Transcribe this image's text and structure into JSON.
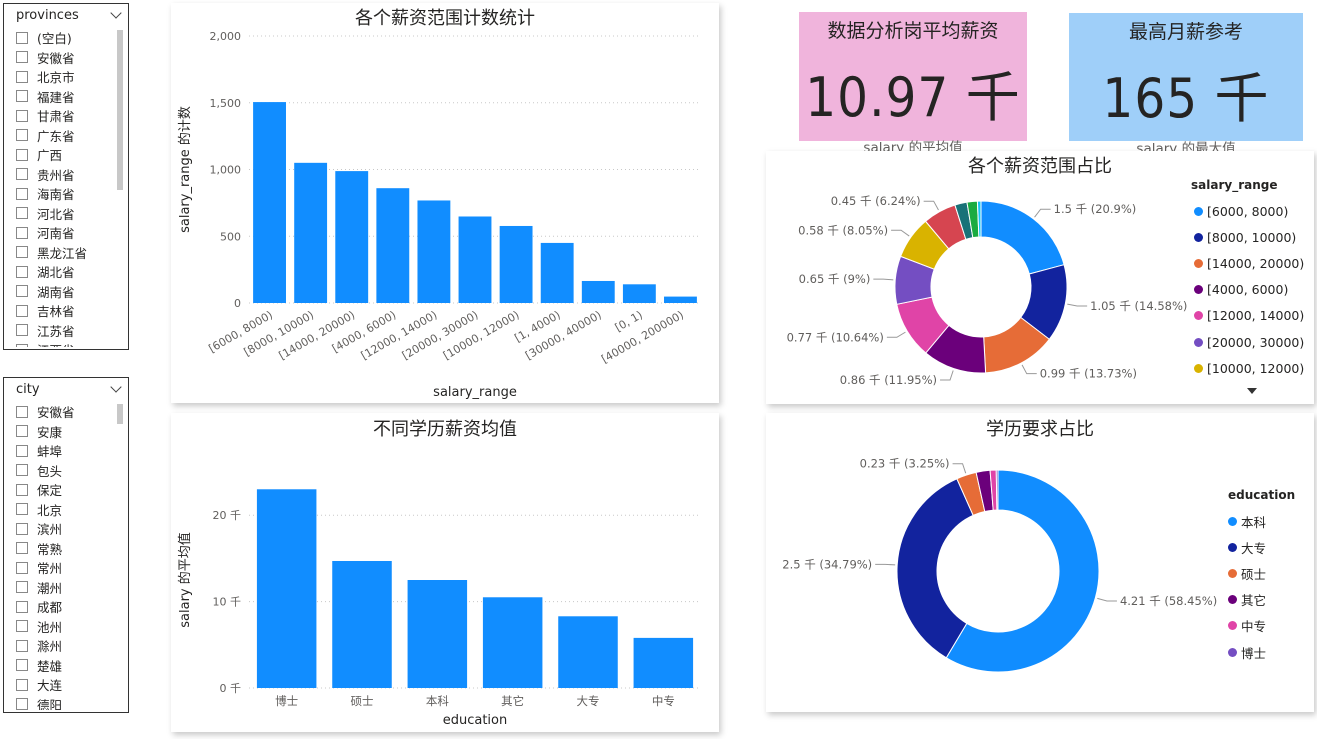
{
  "slicers": {
    "provinces": {
      "title": "provinces",
      "items": [
        "(空白)",
        "安徽省",
        "北京市",
        "福建省",
        "甘肃省",
        "广东省",
        "广西",
        "贵州省",
        "海南省",
        "河北省",
        "河南省",
        "黑龙江省",
        "湖北省",
        "湖南省",
        "吉林省",
        "江苏省",
        "江西省"
      ]
    },
    "city": {
      "title": "city",
      "items": [
        "安徽省",
        "安康",
        "蚌埠",
        "包头",
        "保定",
        "北京",
        "滨州",
        "常熟",
        "常州",
        "潮州",
        "成都",
        "池州",
        "滁州",
        "楚雄",
        "大连",
        "德阳"
      ]
    }
  },
  "kpis": {
    "avg_salary": {
      "title": "数据分析岗平均薪资",
      "value": "10.97 千",
      "subtitle": "salary 的平均值",
      "bg": "#f0b4dc"
    },
    "max_salary": {
      "title": "最高月薪参考",
      "value": "165 千",
      "subtitle": "salary 的最大值",
      "bg": "#9fcff9"
    }
  },
  "chart_data": [
    {
      "id": "salary_range_count",
      "type": "bar",
      "title": "各个薪资范围计数统计",
      "xlabel": "salary_range",
      "ylabel": "salary_range 的计数",
      "categories": [
        "[6000, 8000)",
        "[8000, 10000)",
        "[14000, 20000)",
        "[4000, 6000)",
        "[12000, 14000)",
        "[20000, 30000)",
        "[10000, 12000)",
        "[1, 4000)",
        "[30000, 40000)",
        "[0, 1)",
        "[40000, 200000)"
      ],
      "values": [
        1505,
        1050,
        988,
        860,
        768,
        648,
        577,
        450,
        165,
        140,
        48
      ],
      "ylim": [
        0,
        2000
      ],
      "yticks": [
        0,
        500,
        1000,
        1500,
        2000
      ],
      "ytick_labels": [
        "0",
        "500",
        "1,000",
        "1,500",
        "2,000"
      ],
      "color": "#118dff",
      "grid": true
    },
    {
      "id": "salary_range_share",
      "type": "pie",
      "donut": true,
      "title": "各个薪资范围占比",
      "legend_title": "salary_range",
      "legend_position": "right",
      "slices": [
        {
          "name": "[6000, 8000)",
          "value": 1.5,
          "label": "1.5 千 (20.9%)",
          "color": "#118dff",
          "show_label": true,
          "show_legend": true
        },
        {
          "name": "[8000, 10000)",
          "value": 1.05,
          "label": "1.05 千 (14.58%)",
          "color": "#12239e",
          "show_label": true,
          "show_legend": true
        },
        {
          "name": "[14000, 20000)",
          "value": 0.99,
          "label": "0.99 千 (13.73%)",
          "color": "#e66c37",
          "show_label": true,
          "show_legend": true
        },
        {
          "name": "[4000, 6000)",
          "value": 0.86,
          "label": "0.86 千 (11.95%)",
          "color": "#6b007b",
          "show_label": true,
          "show_legend": true
        },
        {
          "name": "[12000, 14000)",
          "value": 0.77,
          "label": "0.77 千 (10.64%)",
          "color": "#e044a7",
          "show_label": true,
          "show_legend": true
        },
        {
          "name": "[20000, 30000)",
          "value": 0.65,
          "label": "0.65 千 (9%)",
          "color": "#744ec2",
          "show_label": true,
          "show_legend": true
        },
        {
          "name": "[10000, 12000)",
          "value": 0.58,
          "label": "0.58 千 (8.05%)",
          "color": "#d9b300",
          "show_label": true,
          "show_legend": true
        },
        {
          "name": "[1, 4000)",
          "value": 0.45,
          "label": "0.45 千 (6.24%)",
          "color": "#d64550",
          "show_label": true,
          "show_legend": false
        },
        {
          "name": "[30000, 40000)",
          "value": 0.165,
          "label": "",
          "color": "#197278",
          "show_label": false,
          "show_legend": false
        },
        {
          "name": "[0, 1)",
          "value": 0.14,
          "label": "",
          "color": "#1aab40",
          "show_label": false,
          "show_legend": false
        },
        {
          "name": "[40000, 200000)",
          "value": 0.048,
          "label": "",
          "color": "#15c6f4",
          "show_label": false,
          "show_legend": false
        }
      ]
    },
    {
      "id": "education_avg_salary",
      "type": "bar",
      "title": "不同学历薪资均值",
      "xlabel": "education",
      "ylabel": "salary 的平均值",
      "categories": [
        "博士",
        "硕士",
        "本科",
        "其它",
        "大专",
        "中专"
      ],
      "values": [
        23,
        14.7,
        12.5,
        10.5,
        8.3,
        5.8
      ],
      "ylim": [
        0,
        25
      ],
      "yticks": [
        0,
        10,
        20
      ],
      "ytick_labels": [
        "0 千",
        "10 千",
        "20 千"
      ],
      "color": "#118dff",
      "grid": true
    },
    {
      "id": "education_share",
      "type": "pie",
      "donut": true,
      "title": "学历要求占比",
      "legend_title": "education",
      "legend_position": "right",
      "slices": [
        {
          "name": "本科",
          "value": 4.21,
          "label": "4.21 千 (58.45%)",
          "color": "#118dff",
          "show_label": true,
          "show_legend": true
        },
        {
          "name": "大专",
          "value": 2.5,
          "label": "2.5 千 (34.79%)",
          "color": "#12239e",
          "show_label": true,
          "show_legend": true
        },
        {
          "name": "硕士",
          "value": 0.23,
          "label": "0.23 千 (3.25%)",
          "color": "#e66c37",
          "show_label": true,
          "show_legend": true
        },
        {
          "name": "其它",
          "value": 0.16,
          "label": "",
          "color": "#6b007b",
          "show_label": false,
          "show_legend": true
        },
        {
          "name": "中专",
          "value": 0.07,
          "label": "",
          "color": "#e044a7",
          "show_label": false,
          "show_legend": true
        },
        {
          "name": "博士",
          "value": 0.02,
          "label": "",
          "color": "#744ec2",
          "show_label": false,
          "show_legend": true
        }
      ]
    }
  ]
}
